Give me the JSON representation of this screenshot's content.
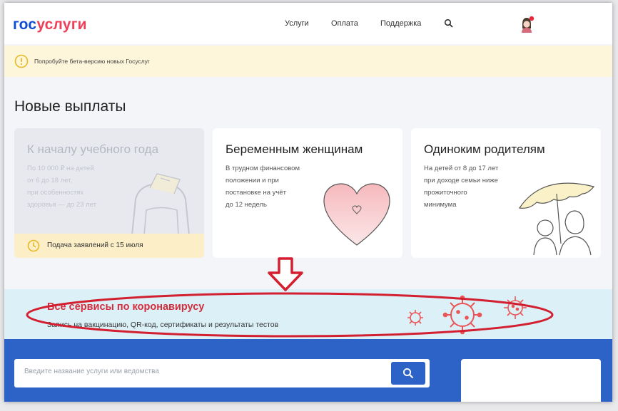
{
  "header": {
    "logo_part1": "гос",
    "logo_part2": "услуги",
    "nav": [
      "Услуги",
      "Оплата",
      "Поддержка"
    ]
  },
  "notice": {
    "text": "Попробуйте бета-версию новых Госуслуг"
  },
  "section_title": "Новые выплаты",
  "cards": [
    {
      "title": "К началу учебного года",
      "lines": [
        "По 10 000 ₽ на детей",
        "от 6 до 18 лет,",
        "при особенностях",
        "здоровья — до 23 лет"
      ],
      "badge": "Подача заявлений с 15 июля",
      "state": "disabled"
    },
    {
      "title": "Беременным женщинам",
      "lines": [
        "В трудном финансовом",
        "положении и при",
        "постановке на учёт",
        "до 12 недель"
      ]
    },
    {
      "title": "Одиноким родителям",
      "lines": [
        "На детей от 8 до 17 лет",
        "при доходе семьи ниже",
        "прожиточного",
        "минимума"
      ]
    }
  ],
  "covid": {
    "title": "Все сервисы по коронавирусу",
    "subtitle": "Запись на вакцинацию, QR-код, сертификаты и результаты тестов"
  },
  "search": {
    "placeholder": "Введите название услуги или ведомства",
    "value": ""
  },
  "colors": {
    "brand_blue": "#0d4cd3",
    "brand_red": "#ee3f58",
    "covid_red": "#d32e3b",
    "search_band": "#2d62c6"
  }
}
